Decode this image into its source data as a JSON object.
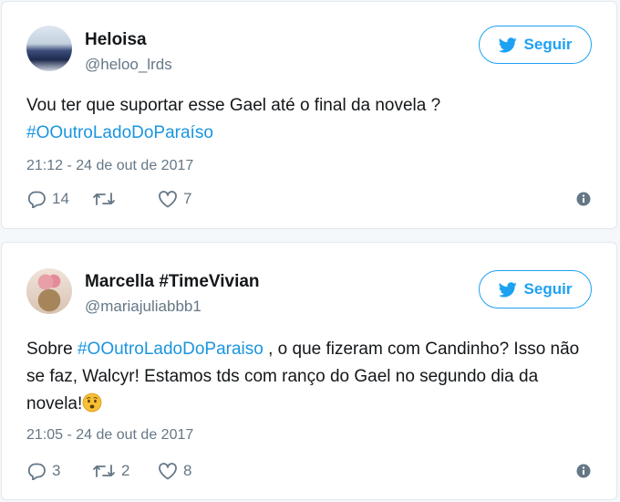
{
  "tweets": [
    {
      "author": {
        "name": "Heloisa",
        "handle": "@heloo_lrds"
      },
      "follow_label": "Seguir",
      "text": "Vou ter que suportar esse Gael até o final da novela ?",
      "hashtag": "#OOutroLadoDoParaíso",
      "timestamp": "21:12 - 24 de out de 2017",
      "stats": {
        "replies": "14",
        "retweets": "",
        "likes": "7"
      }
    },
    {
      "author": {
        "name": "Marcella #TimeVivian",
        "handle": "@mariajuliabbb1"
      },
      "follow_label": "Seguir",
      "text_before": "Sobre ",
      "hashtag": "#OOutroLadoDoParaiso",
      "text_after": " , o que fizeram com Candinho? Isso não se faz, Walcyr! Estamos tds com ranço do Gael no segundo dia da novela!",
      "emoji": "worried-face-icon",
      "timestamp": "21:05 - 24 de out de 2017",
      "stats": {
        "replies": "3",
        "retweets": "2",
        "likes": "8"
      }
    }
  ],
  "colors": {
    "brand": "#1da1f2",
    "hashtag": "#1b95e0",
    "secondary_text": "#657786",
    "border": "#e1e8ed"
  },
  "icons": [
    "twitter-bird-icon",
    "reply-icon",
    "retweet-icon",
    "heart-icon",
    "info-icon",
    "worried-face-icon"
  ]
}
